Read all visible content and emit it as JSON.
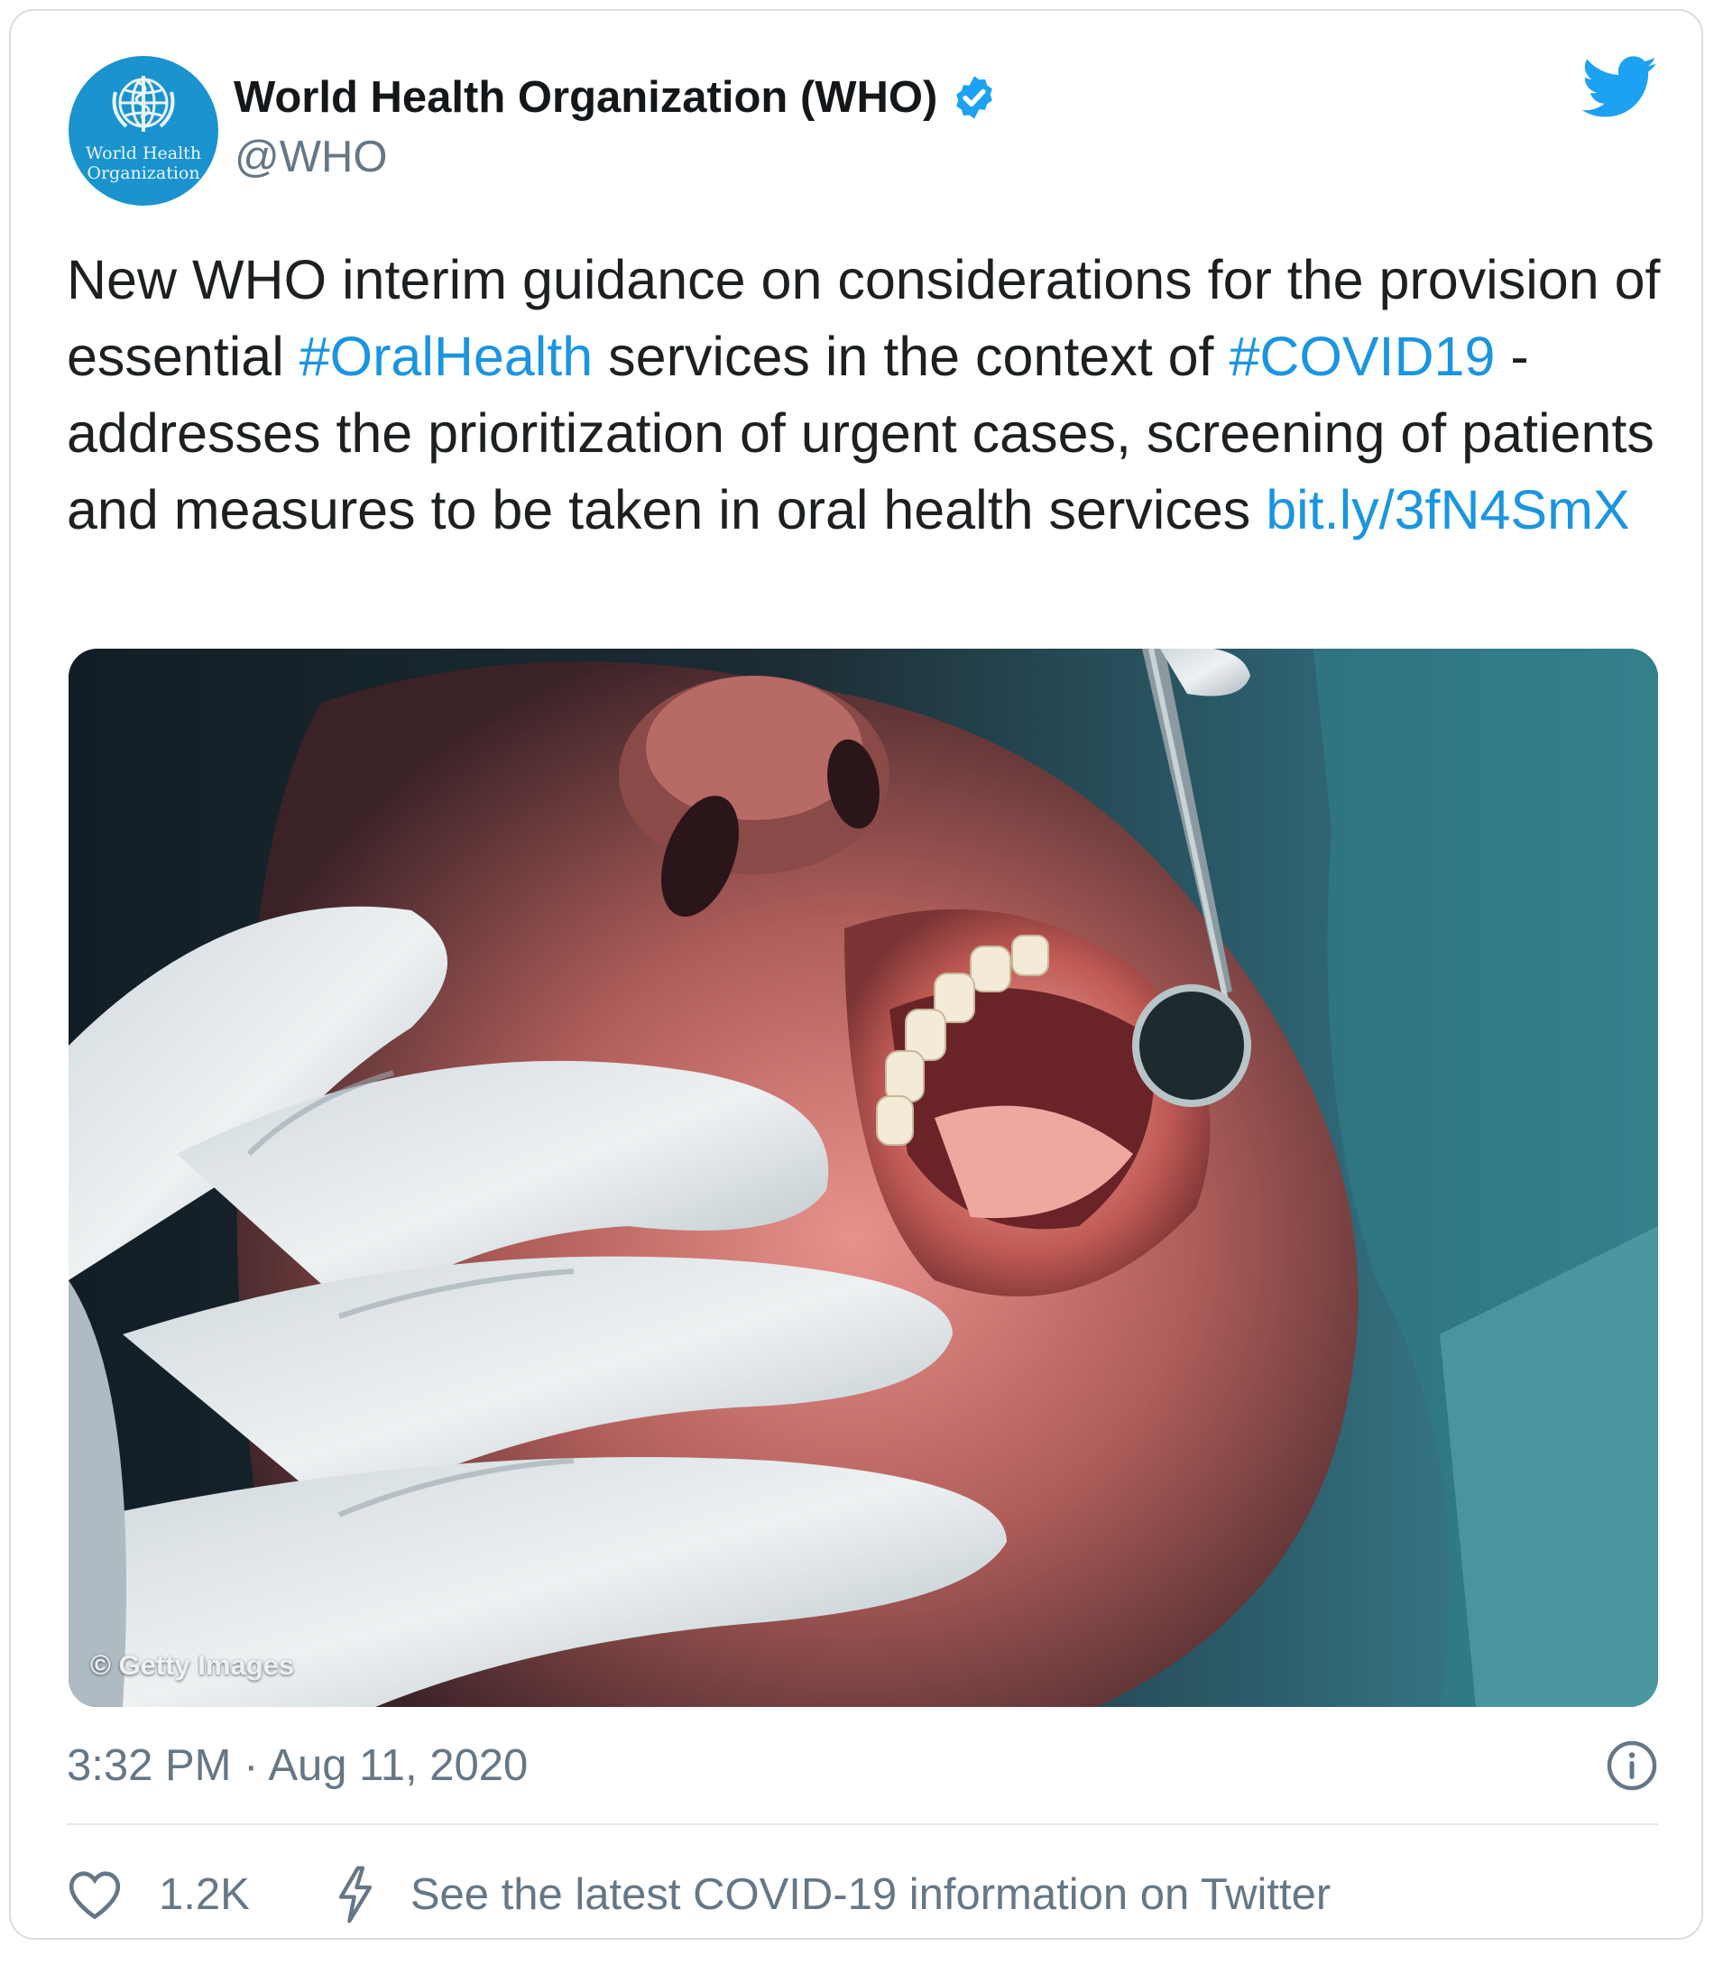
{
  "author": {
    "avatar_line1": "World Health",
    "avatar_line2": "Organization",
    "display_name": "World Health Organization (WHO)",
    "handle": "@WHO",
    "verified": true
  },
  "tweet": {
    "text_1": "New WHO interim guidance on considerations for the provision of essential ",
    "hashtag_1": "#OralHealth",
    "text_2": " services in the context of ",
    "hashtag_2": "#COVID19",
    "text_3": " - addresses the prioritization of urgent cases, screening of patients and measures to be taken in oral health services ",
    "link": "bit.ly/3fN4SmX"
  },
  "media": {
    "credit": "© Getty Images"
  },
  "meta": {
    "timestamp": "3:32 PM · Aug 11, 2020"
  },
  "actions": {
    "like_count": "1.2K",
    "covid_info": "See the latest COVID-19 information on Twitter"
  },
  "colors": {
    "link": "#1b95e0",
    "verified": "#1da1f2",
    "avatar_bg": "#1a93cf",
    "secondary_text": "#657786"
  },
  "icons": [
    "twitter-bird-icon",
    "verified-badge-icon",
    "info-icon",
    "heart-icon",
    "lightning-icon"
  ]
}
